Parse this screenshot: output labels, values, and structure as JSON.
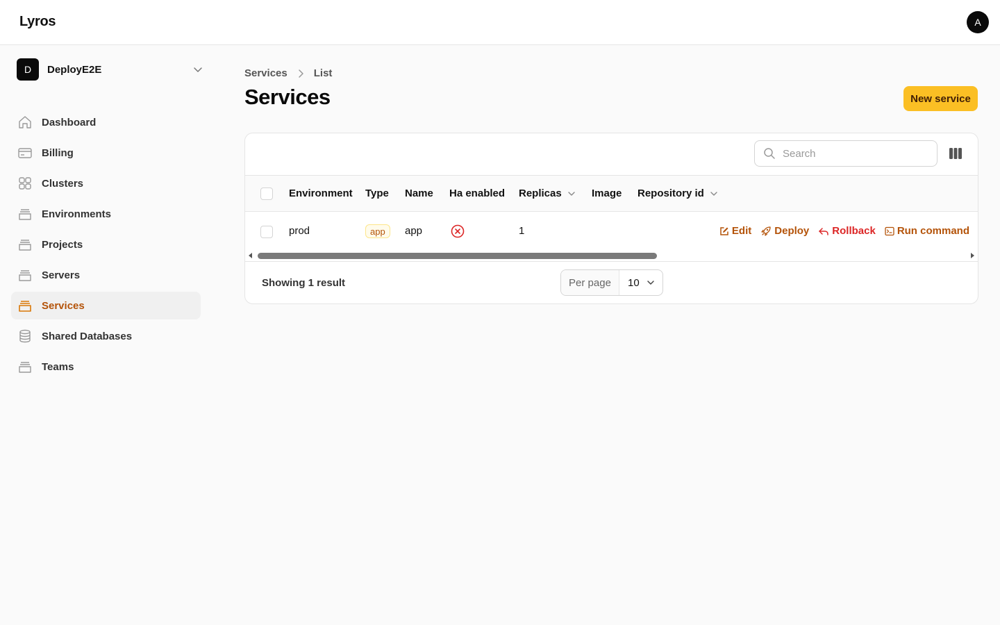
{
  "app": {
    "brand": "Lyros",
    "user_initial": "A"
  },
  "tenant": {
    "initial": "D",
    "name": "DeployE2E"
  },
  "sidebar": {
    "items": [
      {
        "label": "Dashboard",
        "icon": "home-icon",
        "active": false
      },
      {
        "label": "Billing",
        "icon": "credit-card-icon",
        "active": false
      },
      {
        "label": "Clusters",
        "icon": "grid-icon",
        "active": false
      },
      {
        "label": "Environments",
        "icon": "box-stack-icon",
        "active": false
      },
      {
        "label": "Projects",
        "icon": "box-stack-icon",
        "active": false
      },
      {
        "label": "Servers",
        "icon": "box-stack-icon",
        "active": false
      },
      {
        "label": "Services",
        "icon": "box-stack-icon",
        "active": true
      },
      {
        "label": "Shared Databases",
        "icon": "database-icon",
        "active": false
      },
      {
        "label": "Teams",
        "icon": "box-stack-icon",
        "active": false
      }
    ]
  },
  "breadcrumb": {
    "parent": "Services",
    "current": "List"
  },
  "page": {
    "title": "Services",
    "new_button": "New service"
  },
  "table": {
    "search_placeholder": "Search",
    "columns": [
      "Environment",
      "Type",
      "Name",
      "Ha enabled",
      "Replicas",
      "Image",
      "Repository id"
    ],
    "rows": [
      {
        "environment": "prod",
        "type": "app",
        "name": "app",
        "ha_enabled": false,
        "replicas": "1",
        "image": "",
        "repository_id": ""
      }
    ],
    "actions": {
      "edit": "Edit",
      "deploy": "Deploy",
      "rollback": "Rollback",
      "run_command": "Run command"
    },
    "showing": "Showing 1 result",
    "per_page_label": "Per page",
    "per_page_value": "10"
  },
  "colors": {
    "accent": "#b45309",
    "primary_button": "#fbbf24",
    "danger": "#dc2626"
  }
}
